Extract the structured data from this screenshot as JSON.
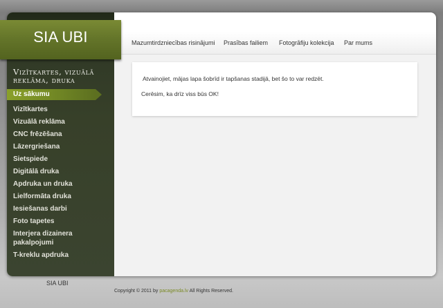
{
  "logo": "SIA UBI",
  "tagline": "Vizītkartes, vizuālā reklāma, druka",
  "sidebar": {
    "active": "Uz sākumu",
    "items": [
      "Vizītkartes",
      "Vizuālā reklāma",
      "CNC frēzēšana",
      "Lāzergriešana",
      "Sietspiede",
      "Digitālā druka",
      "Apdruka un druka",
      "Lielformāta druka",
      "Iesiešanas darbi",
      "Foto tapetes",
      "Interjera dizainera pakalpojumi",
      "T-kreklu apdruka"
    ]
  },
  "topnav": {
    "tabs": [
      "Mazumtirdzniecības risinājumi",
      "Prasības failiem",
      "Fotogrāfiju kolekcija",
      "Par mums"
    ]
  },
  "content": {
    "line1": "Atvainojiet, mājas lapa šobrīd ir tapšanas stadijā, bet šo to var redzēt.",
    "line2": "Cerēsim, ka drīz viss būs OK!"
  },
  "footer": {
    "brand": "SIA UBI",
    "copy_prefix": "Copyright © 2011 by",
    "copy_link": "pacagenda.lv",
    "copy_suffix": "All Rights Reserved."
  },
  "colors": {
    "sidebar_bg": "#374029",
    "accent_green": "#6f8524",
    "link_green": "#7a8a24"
  }
}
